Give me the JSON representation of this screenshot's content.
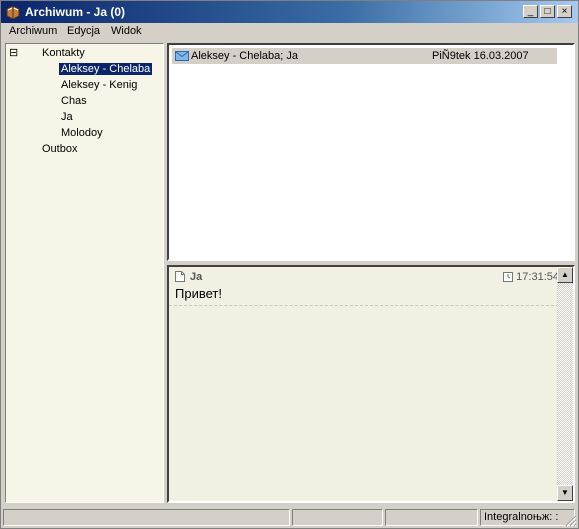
{
  "window": {
    "title": "Archiwum - Ja (0)"
  },
  "titlebar": {
    "minimize": "_",
    "maximize": "□",
    "close": "×"
  },
  "menu": [
    {
      "label": "Archiwum"
    },
    {
      "label": "Edycja"
    },
    {
      "label": "Widok"
    }
  ],
  "tree": {
    "expander": "⊟",
    "root": "Kontakty",
    "children": [
      {
        "label": "Aleksey - Chelaba",
        "selected": true
      },
      {
        "label": "Aleksey - Kenig"
      },
      {
        "label": "Chas"
      },
      {
        "label": "Ja"
      },
      {
        "label": "Molodoy"
      }
    ],
    "outbox": "Outbox"
  },
  "messages": [
    {
      "from": "Aleksey - Chelaba; Ja",
      "date": "PiÑ9tek 16.03.2007",
      "icon": "envelope-icon"
    }
  ],
  "chat": {
    "name": "Ja",
    "time": "17:31:54",
    "text": "Привет!"
  },
  "status": {
    "panel4": "Integralnoњж: :"
  },
  "colors": {
    "selection": "#0a246a",
    "title_start": "#0a246a",
    "pane_bg": "#f7f5e7",
    "chat_bg": "#f1f0e3",
    "msg_row": "#d4d0c8"
  }
}
